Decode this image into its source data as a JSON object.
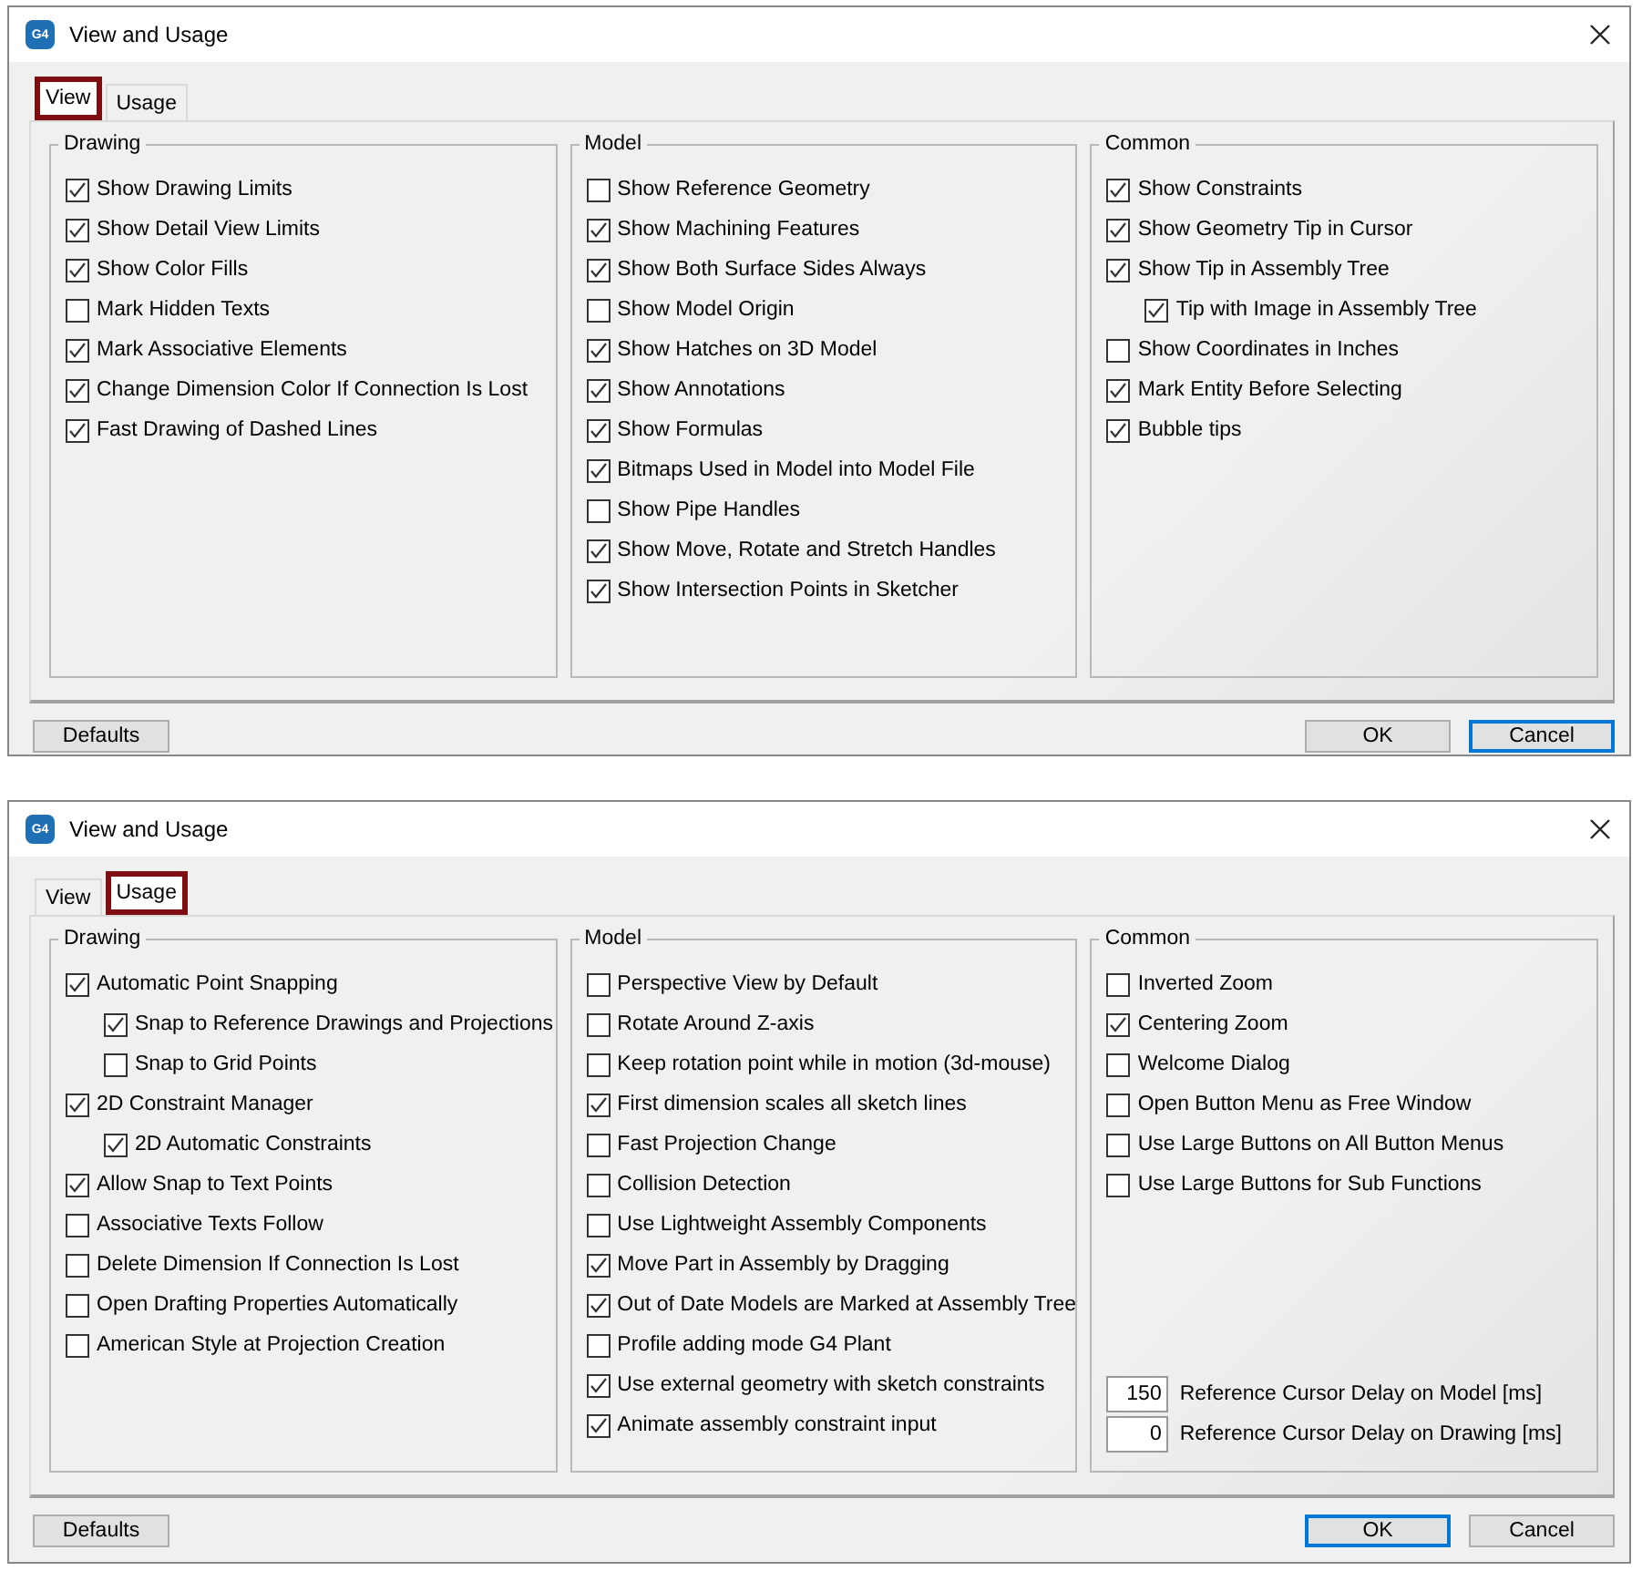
{
  "dialogs": [
    {
      "app_icon": "G4",
      "title": "View and Usage",
      "tabs": [
        {
          "label": "View",
          "selected": true
        },
        {
          "label": "Usage",
          "selected": false
        }
      ],
      "groups": [
        {
          "title": "Drawing",
          "items": [
            {
              "label": "Show Drawing Limits",
              "checked": true
            },
            {
              "label": "Show Detail View Limits",
              "checked": true
            },
            {
              "label": "Show Color Fills",
              "checked": true
            },
            {
              "label": "Mark Hidden Texts",
              "checked": false
            },
            {
              "label": "Mark Associative Elements",
              "checked": true
            },
            {
              "label": "Change Dimension Color If Connection Is Lost",
              "checked": true
            },
            {
              "label": "Fast Drawing of Dashed Lines",
              "checked": true
            }
          ]
        },
        {
          "title": "Model",
          "items": [
            {
              "label": "Show Reference Geometry",
              "checked": false
            },
            {
              "label": "Show Machining Features",
              "checked": true
            },
            {
              "label": "Show Both Surface Sides Always",
              "checked": true
            },
            {
              "label": "Show Model Origin",
              "checked": false
            },
            {
              "label": "Show Hatches on 3D Model",
              "checked": true
            },
            {
              "label": "Show Annotations",
              "checked": true
            },
            {
              "label": "Show Formulas",
              "checked": true
            },
            {
              "label": "Bitmaps Used in Model into Model File",
              "checked": true
            },
            {
              "label": "Show Pipe Handles",
              "checked": false
            },
            {
              "label": "Show Move, Rotate and Stretch Handles",
              "checked": true
            },
            {
              "label": "Show Intersection Points in Sketcher",
              "checked": true
            }
          ]
        },
        {
          "title": "Common",
          "items": [
            {
              "label": "Show Constraints",
              "checked": true
            },
            {
              "label": "Show Geometry Tip in Cursor",
              "checked": true
            },
            {
              "label": "Show Tip in Assembly Tree",
              "checked": true,
              "children": [
                {
                  "label": "Tip with Image in Assembly Tree",
                  "checked": true
                }
              ]
            },
            {
              "label": "Show Coordinates in Inches",
              "checked": false
            },
            {
              "label": "Mark Entity Before Selecting",
              "checked": true
            },
            {
              "label": "Bubble tips",
              "checked": true
            }
          ]
        }
      ],
      "buttons": [
        {
          "label": "Defaults",
          "focused": false
        },
        {
          "label": "OK",
          "focused": false
        },
        {
          "label": "Cancel",
          "focused": true
        }
      ]
    },
    {
      "app_icon": "G4",
      "title": "View and Usage",
      "tabs": [
        {
          "label": "View",
          "selected": false
        },
        {
          "label": "Usage",
          "selected": true
        }
      ],
      "groups": [
        {
          "title": "Drawing",
          "items": [
            {
              "label": "Automatic Point Snapping",
              "checked": true,
              "children": [
                {
                  "label": "Snap to Reference Drawings and Projections",
                  "checked": true
                },
                {
                  "label": "Snap to Grid Points",
                  "checked": false
                }
              ]
            },
            {
              "label": "2D Constraint Manager",
              "checked": true,
              "children": [
                {
                  "label": "2D Automatic Constraints",
                  "checked": true
                }
              ]
            },
            {
              "label": "Allow Snap to Text Points",
              "checked": true
            },
            {
              "label": "Associative Texts Follow",
              "checked": false
            },
            {
              "label": "Delete Dimension If Connection Is Lost",
              "checked": false
            },
            {
              "label": "Open Drafting Properties Automatically",
              "checked": false
            },
            {
              "label": "American Style at Projection Creation",
              "checked": false
            }
          ]
        },
        {
          "title": "Model",
          "items": [
            {
              "label": "Perspective View by Default",
              "checked": false
            },
            {
              "label": "Rotate Around Z-axis",
              "checked": false
            },
            {
              "label": "Keep rotation point while in motion (3d-mouse)",
              "checked": false
            },
            {
              "label": "First dimension scales all sketch lines",
              "checked": true
            },
            {
              "label": "Fast Projection Change",
              "checked": false
            },
            {
              "label": "Collision Detection",
              "checked": false
            },
            {
              "label": "Use Lightweight Assembly Components",
              "checked": false
            },
            {
              "label": "Move Part in Assembly by Dragging",
              "checked": true
            },
            {
              "label": "Out of Date Models are Marked at Assembly Tree",
              "checked": true
            },
            {
              "label": "Profile adding mode G4 Plant",
              "checked": false
            },
            {
              "label": "Use external geometry with sketch constraints",
              "checked": true
            },
            {
              "label": "Animate assembly constraint input",
              "checked": true
            }
          ]
        },
        {
          "title": "Common",
          "items": [
            {
              "label": "Inverted Zoom",
              "checked": false
            },
            {
              "label": "Centering Zoom",
              "checked": true
            },
            {
              "label": "Welcome Dialog",
              "checked": false
            },
            {
              "label": "Open Button Menu as Free Window",
              "checked": false
            },
            {
              "label": "Use Large Buttons on All Button Menus",
              "checked": false
            },
            {
              "label": "Use Large Buttons for Sub Functions",
              "checked": false
            }
          ],
          "fields": [
            {
              "value": "150",
              "label": "Reference Cursor Delay on Model [ms]"
            },
            {
              "value": "0",
              "label": "Reference Cursor Delay on Drawing [ms]"
            }
          ]
        }
      ],
      "buttons": [
        {
          "label": "Defaults",
          "focused": false
        },
        {
          "label": "OK",
          "focused": true
        },
        {
          "label": "Cancel",
          "focused": false
        }
      ]
    }
  ]
}
